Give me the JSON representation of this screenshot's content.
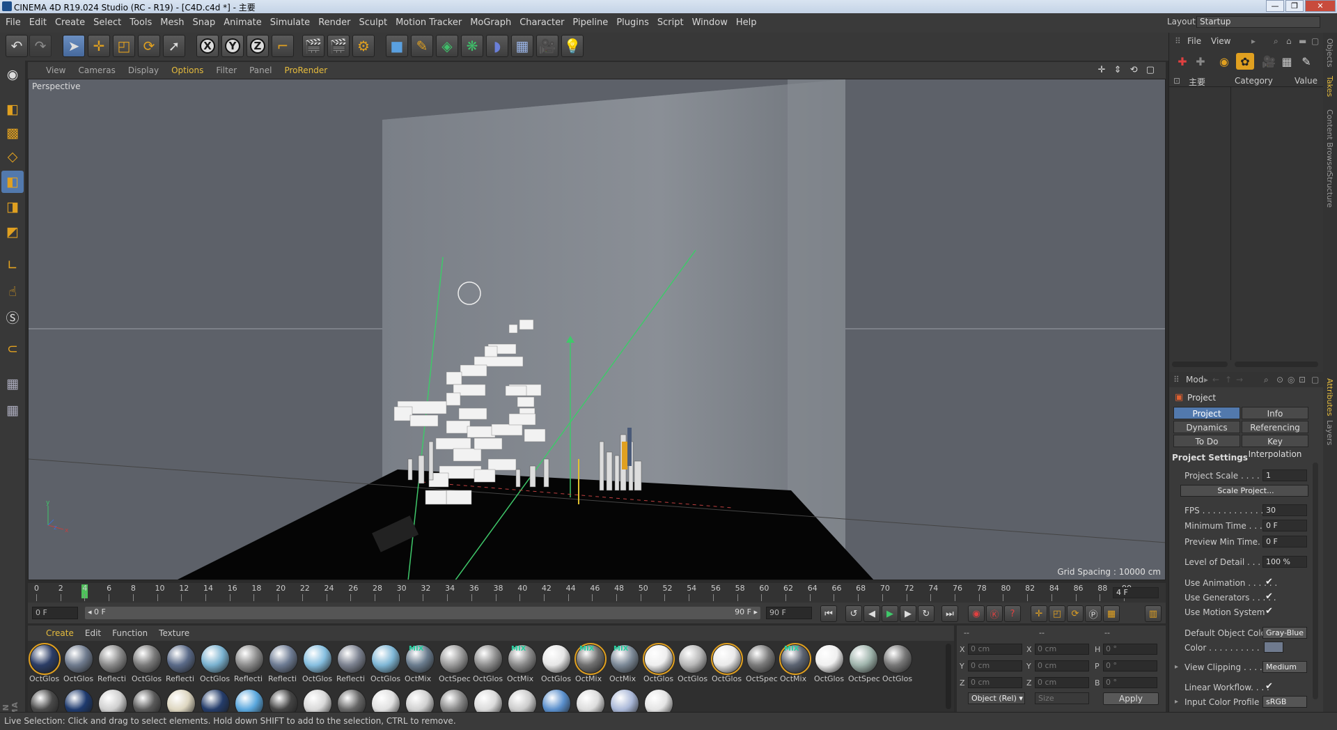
{
  "window": {
    "title": "CINEMA 4D R19.024 Studio (RC - R19) - [C4D.c4d *] - 主要",
    "minimize": "—",
    "maximize": "❐",
    "close": "✕"
  },
  "menubar": {
    "items": [
      "File",
      "Edit",
      "Create",
      "Select",
      "Tools",
      "Mesh",
      "Snap",
      "Animate",
      "Simulate",
      "Render",
      "Sculpt",
      "Motion Tracker",
      "MoGraph",
      "Character",
      "Pipeline",
      "Plugins",
      "Script",
      "Window",
      "Help"
    ],
    "layout_label": "Layout:",
    "layout_value": "Startup"
  },
  "toolbar": {
    "axis_x": "X",
    "axis_y": "Y",
    "axis_z": "Z"
  },
  "viewport": {
    "menus": [
      "View",
      "Cameras",
      "Display",
      "Options",
      "Filter",
      "Panel",
      "ProRender"
    ],
    "highlighted_menu": "Options",
    "label": "Perspective",
    "grid_spacing": "Grid Spacing : 10000 cm",
    "nav_icons": "✛ ⇕ ⟲ ▢"
  },
  "timeline": {
    "ticks": [
      "0",
      "2",
      "4",
      "6",
      "8",
      "10",
      "12",
      "14",
      "16",
      "18",
      "20",
      "22",
      "24",
      "26",
      "28",
      "30",
      "32",
      "34",
      "36",
      "38",
      "40",
      "42",
      "44",
      "46",
      "48",
      "50",
      "52",
      "54",
      "56",
      "58",
      "60",
      "62",
      "64",
      "66",
      "68",
      "70",
      "72",
      "74",
      "76",
      "78",
      "80",
      "82",
      "84",
      "86",
      "88",
      "90"
    ],
    "current_frame": "4 F",
    "playhead_frame": 4
  },
  "transport": {
    "start_field": "0 F",
    "range_start": "◂ 0 F",
    "range_end": "90 F ▸",
    "end_field": "90 F"
  },
  "material_manager": {
    "menus": [
      "Create",
      "Edit",
      "Function",
      "Texture"
    ],
    "highlighted_menu": "Create",
    "materials": [
      {
        "label": "OctGlos",
        "color": "#2c3d66",
        "mix": false,
        "selected": true
      },
      {
        "label": "OctGlos",
        "color": "#6f7b8e",
        "mix": false,
        "selected": false
      },
      {
        "label": "Reflecti",
        "color": "#8a8a8a",
        "mix": false,
        "selected": false
      },
      {
        "label": "OctGlos",
        "color": "#7a7a7a",
        "mix": false,
        "selected": false
      },
      {
        "label": "Reflecti",
        "color": "#5a6a88",
        "mix": false,
        "selected": false
      },
      {
        "label": "OctGlos",
        "color": "#7ab2d0",
        "mix": false,
        "selected": false
      },
      {
        "label": "Reflecti",
        "color": "#8c8c8c",
        "mix": false,
        "selected": false
      },
      {
        "label": "Reflecti",
        "color": "#6e7c94",
        "mix": false,
        "selected": false
      },
      {
        "label": "OctGlos",
        "color": "#86bfe0",
        "mix": false,
        "selected": false
      },
      {
        "label": "Reflecti",
        "color": "#7c8290",
        "mix": false,
        "selected": false
      },
      {
        "label": "OctGlos",
        "color": "#7fb7d6",
        "mix": false,
        "selected": false
      },
      {
        "label": "OctMix",
        "color": "#6a7c8e",
        "mix": true,
        "selected": false
      },
      {
        "label": "OctSpec",
        "color": "#9a9a9a",
        "mix": false,
        "selected": false
      },
      {
        "label": "OctGlos",
        "color": "#8e8e8e",
        "mix": false,
        "selected": false
      },
      {
        "label": "OctMix",
        "color": "#8a8a8a",
        "mix": true,
        "selected": false
      },
      {
        "label": "OctGlos",
        "color": "#e6e6e6",
        "mix": false,
        "selected": false
      },
      {
        "label": "OctMix",
        "color": "#707070",
        "mix": true,
        "selected": true
      },
      {
        "label": "OctMix",
        "color": "#7d8a98",
        "mix": true,
        "selected": false
      },
      {
        "label": "OctGlos",
        "color": "#efefef",
        "mix": false,
        "selected": true
      },
      {
        "label": "OctGlos",
        "color": "#b8b8b8",
        "mix": false,
        "selected": false
      },
      {
        "label": "OctGlos",
        "color": "#eaeaea",
        "mix": false,
        "selected": true
      },
      {
        "label": "OctSpec",
        "color": "#7a7a7a",
        "mix": false,
        "selected": false
      },
      {
        "label": "OctMix",
        "color": "#5c6472",
        "mix": true,
        "selected": true
      },
      {
        "label": "OctGlos",
        "color": "#f0f0f0",
        "mix": false,
        "selected": false
      },
      {
        "label": "OctSpec",
        "color": "#9fb4ac",
        "mix": false,
        "selected": false
      },
      {
        "label": "OctGlos",
        "color": "#777777",
        "mix": false,
        "selected": false
      }
    ],
    "row2_colors": [
      "#4a4a4a",
      "#1e3a6e",
      "#cfcfcf",
      "#5a5a5a",
      "#ddd6c0",
      "#243c6a",
      "#5aa7dd",
      "#444444",
      "#d8d8d8",
      "#666666",
      "#e0e0e0",
      "#d0d0d0",
      "#888888",
      "#dadada",
      "#cccccc",
      "#5a8fcc",
      "#dcdcdc",
      "#aab8d8",
      "#e4e4e4"
    ]
  },
  "coordinates": {
    "col1": [
      "X",
      "Y",
      "Z"
    ],
    "col2": [
      "X",
      "Y",
      "Z"
    ],
    "col3": [
      "H",
      "P",
      "B"
    ],
    "pos": [
      "0 cm",
      "0 cm",
      "0 cm"
    ],
    "size": [
      "0 cm",
      "0 cm",
      "0 cm"
    ],
    "rot": [
      "0 °",
      "0 °",
      "0 °"
    ],
    "headers": [
      "--",
      "--",
      "--"
    ],
    "mode": "Object (Rel) ▾",
    "size_mode": "Size",
    "apply": "Apply"
  },
  "object_manager": {
    "menus": [
      "File",
      "View"
    ],
    "columns": [
      "主要",
      "Category",
      "Value"
    ]
  },
  "side_tabs": [
    "Objects",
    "Takes",
    "Content Browser",
    "Structure"
  ],
  "side_tabs_lower": [
    "Attributes",
    "Layers"
  ],
  "attributes": {
    "mode_label": "Mod",
    "object_label": "Project",
    "tabs": [
      "Project Settings",
      "Info",
      "Dynamics",
      "Referencing",
      "To Do",
      "Key Interpolation"
    ],
    "section": "Project Settings",
    "project_scale_label": "Project Scale . . . . . . .",
    "project_scale_value": "1",
    "scale_project_button": "Scale Project...",
    "fps_label": "FPS . . . . . . . . . . . . . . .",
    "fps_value": "30",
    "min_time_label": "Minimum Time . . . . . .",
    "min_time_value": "0 F",
    "preview_min_label": "Preview Min Time. . . .",
    "preview_min_value": "0 F",
    "lod_label": "Level of Detail . . . . . .",
    "lod_value": "100 %",
    "use_animation_label": "Use Animation . . . . . .",
    "use_generators_label": "Use Generators . . . . .",
    "use_motion_label": "Use Motion System",
    "default_color_label": "Default Object Color",
    "default_color_value": "Gray-Blue",
    "color_label": "Color . . . . . . . . . .",
    "view_clipping_label": "View Clipping . . . . . .",
    "view_clipping_value": "Medium",
    "linear_workflow_label": "Linear Workflow. . . .",
    "input_color_label": "Input Color Profile . .",
    "input_color_value": "sRGB",
    "check": "✔"
  },
  "statusbar": {
    "text": "Live Selection: Click and drag to select elements. Hold down SHIFT to add to the selection, CTRL to remove."
  }
}
